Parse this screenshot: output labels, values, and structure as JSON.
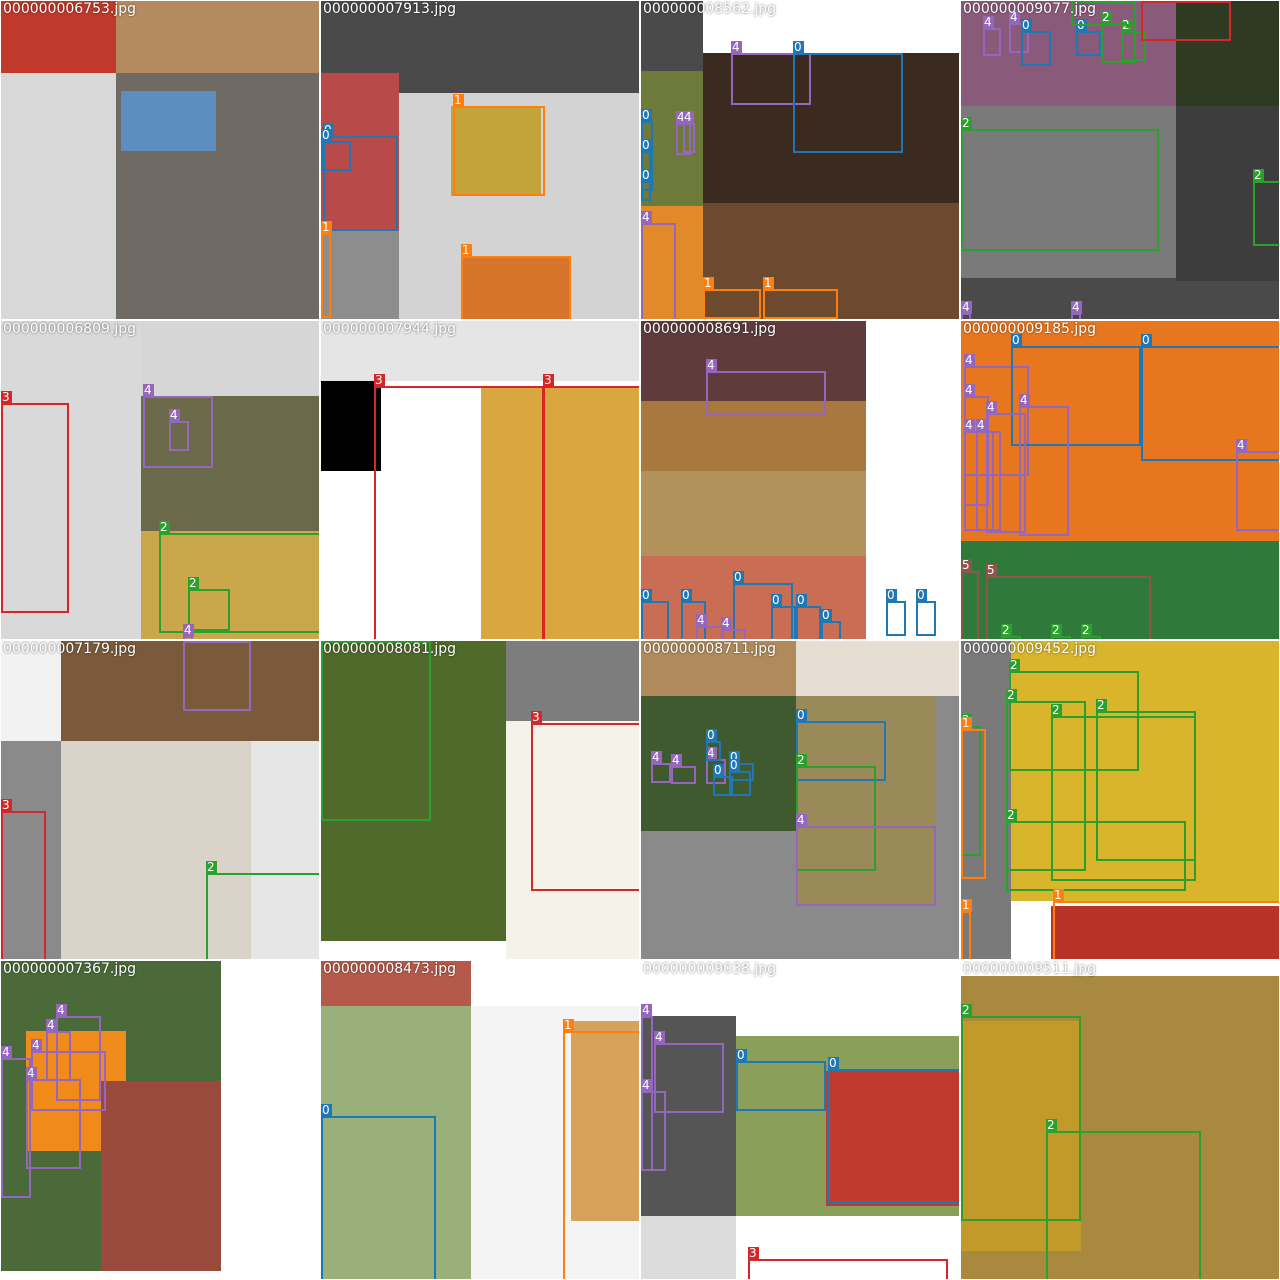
{
  "class_colors": {
    "0": "#1f77b4",
    "1": "#ff7f0e",
    "2": "#2ca02c",
    "3": "#d62728",
    "4": "#9467bd",
    "5": "#8c564b"
  },
  "tiles": [
    {
      "filename": "000000006753.jpg",
      "bg": "#d6d6d6",
      "areas": [
        {
          "kind": "photo",
          "color": "#c0392b"
        },
        {
          "kind": "photo",
          "color": "#b58a5f"
        },
        {
          "kind": "pad",
          "color": "#d8d8d8"
        },
        {
          "kind": "photo",
          "color": "#6f6a64"
        },
        {
          "kind": "photo",
          "color": "#5c8fbf"
        }
      ],
      "boxes": []
    },
    {
      "filename": "000000007913.jpg",
      "bg": "#4a4a4a",
      "areas": [
        {
          "kind": "photo",
          "color": "#b94a4a"
        },
        {
          "kind": "pad",
          "color": "#d3d3d3"
        },
        {
          "kind": "photo",
          "color": "#c4a33a"
        },
        {
          "kind": "photo",
          "color": "#d7742c"
        },
        {
          "kind": "photo",
          "color": "#8d8d8d"
        }
      ],
      "boxes": [
        {
          "cls": "1"
        },
        {
          "cls": "0"
        },
        {
          "cls": "0"
        },
        {
          "cls": "1"
        },
        {
          "cls": "1"
        }
      ]
    },
    {
      "filename": "000000008562.jpg",
      "bg": "#4a4a4a",
      "areas": [
        {
          "kind": "photo",
          "color": "#6e7a3a"
        },
        {
          "kind": "photo",
          "color": "#3a2a20"
        },
        {
          "kind": "photo",
          "color": "#6d4a2e"
        },
        {
          "kind": "photo",
          "color": "#e28a2a"
        },
        {
          "kind": "pad",
          "color": "#ffffff"
        }
      ],
      "boxes": [
        {
          "cls": "4"
        },
        {
          "cls": "0"
        },
        {
          "cls": "0"
        },
        {
          "cls": "0"
        },
        {
          "cls": "4"
        },
        {
          "cls": "4"
        },
        {
          "cls": "0"
        },
        {
          "cls": "4"
        },
        {
          "cls": "1"
        },
        {
          "cls": "1"
        }
      ]
    },
    {
      "filename": "000000009077.jpg",
      "bg": "#4a4a4a",
      "areas": [
        {
          "kind": "photo",
          "color": "#8a5a7a"
        },
        {
          "kind": "photo",
          "color": "#2f3a22"
        },
        {
          "kind": "photo",
          "color": "#7a7a7a"
        },
        {
          "kind": "photo",
          "color": "#3d3d3d"
        }
      ],
      "boxes": [
        {
          "cls": "4"
        },
        {
          "cls": "4"
        },
        {
          "cls": "0"
        },
        {
          "cls": "0"
        },
        {
          "cls": "2"
        },
        {
          "cls": "2"
        },
        {
          "cls": "2"
        },
        {
          "cls": "2"
        },
        {
          "cls": "3"
        },
        {
          "cls": "2"
        },
        {
          "cls": "4"
        },
        {
          "cls": "4"
        }
      ]
    },
    {
      "filename": "000000006809.jpg",
      "bg": "#d6d6d6",
      "areas": [
        {
          "kind": "pad",
          "color": "#d9d9d9"
        },
        {
          "kind": "photo",
          "color": "#000000"
        },
        {
          "kind": "photo",
          "color": "#6a6a4a"
        },
        {
          "kind": "photo",
          "color": "#c9a74a"
        }
      ],
      "boxes": [
        {
          "cls": "3"
        },
        {
          "cls": "4"
        },
        {
          "cls": "4"
        },
        {
          "cls": "2"
        },
        {
          "cls": "2"
        },
        {
          "cls": "4"
        },
        {
          "cls": "2"
        }
      ]
    },
    {
      "filename": "000000007944.jpg",
      "bg": "#ffffff",
      "areas": [
        {
          "kind": "photo",
          "color": "#e5e5e5"
        },
        {
          "kind": "photo",
          "color": "#000000"
        },
        {
          "kind": "photo",
          "color": "#ffffff"
        },
        {
          "kind": "photo",
          "color": "#d9a640"
        }
      ],
      "boxes": [
        {
          "cls": "3"
        },
        {
          "cls": "3"
        }
      ]
    },
    {
      "filename": "000000008691.jpg",
      "bg": "#ffffff",
      "areas": [
        {
          "kind": "photo",
          "color": "#5f3b3b"
        },
        {
          "kind": "photo",
          "color": "#a8783e"
        },
        {
          "kind": "photo",
          "color": "#b1925a"
        },
        {
          "kind": "photo",
          "color": "#c96e54"
        }
      ],
      "boxes": [
        {
          "cls": "4"
        },
        {
          "cls": "0"
        },
        {
          "cls": "0"
        },
        {
          "cls": "0"
        },
        {
          "cls": "0"
        },
        {
          "cls": "0"
        },
        {
          "cls": "0"
        },
        {
          "cls": "0"
        },
        {
          "cls": "0"
        },
        {
          "cls": "4"
        },
        {
          "cls": "4"
        }
      ]
    },
    {
      "filename": "000000009185.jpg",
      "bg": "#ffffff",
      "areas": [
        {
          "kind": "photo",
          "color": "#e8761e"
        },
        {
          "kind": "photo",
          "color": "#2f7a3a"
        }
      ],
      "boxes": [
        {
          "cls": "4"
        },
        {
          "cls": "4"
        },
        {
          "cls": "0"
        },
        {
          "cls": "0"
        },
        {
          "cls": "4"
        },
        {
          "cls": "4"
        },
        {
          "cls": "4"
        },
        {
          "cls": "4"
        },
        {
          "cls": "4"
        },
        {
          "cls": "5"
        },
        {
          "cls": "5"
        },
        {
          "cls": "2"
        },
        {
          "cls": "2"
        },
        {
          "cls": "2"
        }
      ]
    },
    {
      "filename": "000000007179.jpg",
      "bg": "#d6d6d6",
      "areas": [
        {
          "kind": "pad",
          "color": "#f2f2f2"
        },
        {
          "kind": "photo",
          "color": "#7a5a3a"
        },
        {
          "kind": "photo",
          "color": "#8a8a8a"
        },
        {
          "kind": "photo",
          "color": "#d9d3c9"
        },
        {
          "kind": "photo",
          "color": "#e6e6e6"
        }
      ],
      "boxes": [
        {
          "cls": "4"
        },
        {
          "cls": "3"
        },
        {
          "cls": "2"
        }
      ]
    },
    {
      "filename": "000000008081.jpg",
      "bg": "#ffffff",
      "areas": [
        {
          "kind": "photo",
          "color": "#4f6a2a"
        },
        {
          "kind": "pad",
          "color": "#7d7d7d"
        },
        {
          "kind": "photo",
          "color": "#f5f2ea"
        }
      ],
      "boxes": [
        {
          "cls": "2"
        },
        {
          "cls": "3"
        }
      ]
    },
    {
      "filename": "000000008711.jpg",
      "bg": "#8a8a8a",
      "areas": [
        {
          "kind": "photo",
          "color": "#b08a5a"
        },
        {
          "kind": "photo",
          "color": "#3e5a2e"
        },
        {
          "kind": "photo",
          "color": "#e6ded2"
        },
        {
          "kind": "photo",
          "color": "#9a8a5a"
        }
      ],
      "boxes": [
        {
          "cls": "0"
        },
        {
          "cls": "2"
        },
        {
          "cls": "4"
        },
        {
          "cls": "4"
        },
        {
          "cls": "4"
        },
        {
          "cls": "4"
        },
        {
          "cls": "0"
        },
        {
          "cls": "0"
        },
        {
          "cls": "0"
        },
        {
          "cls": "0"
        },
        {
          "cls": "0"
        }
      ]
    },
    {
      "filename": "000000009452.jpg",
      "bg": "#ffffff",
      "areas": [
        {
          "kind": "photo",
          "color": "#7a7a7a"
        },
        {
          "kind": "photo",
          "color": "#d8b52a"
        },
        {
          "kind": "photo",
          "color": "#b8322a"
        }
      ],
      "boxes": [
        {
          "cls": "2"
        },
        {
          "cls": "2"
        },
        {
          "cls": "2"
        },
        {
          "cls": "2"
        },
        {
          "cls": "2"
        },
        {
          "cls": "2"
        },
        {
          "cls": "1"
        },
        {
          "cls": "1"
        },
        {
          "cls": "1"
        }
      ]
    },
    {
      "filename": "000000007367.jpg",
      "bg": "#ffffff",
      "areas": [
        {
          "kind": "photo",
          "color": "#4a6a3a"
        },
        {
          "kind": "photo",
          "color": "#f08a1a"
        },
        {
          "kind": "photo",
          "color": "#9a4a3a"
        }
      ],
      "boxes": [
        {
          "cls": "4"
        },
        {
          "cls": "4"
        },
        {
          "cls": "4"
        },
        {
          "cls": "4"
        },
        {
          "cls": "4"
        }
      ]
    },
    {
      "filename": "000000008473.jpg",
      "bg": "#ffffff",
      "areas": [
        {
          "kind": "photo",
          "color": "#b55a4a"
        },
        {
          "kind": "photo",
          "color": "#9ab07a"
        },
        {
          "kind": "photo",
          "color": "#f4f4f4"
        },
        {
          "kind": "photo",
          "color": "#d7a35a"
        }
      ],
      "boxes": [
        {
          "cls": "1"
        },
        {
          "cls": "0"
        }
      ]
    },
    {
      "filename": "000000009038.jpg",
      "bg": "#ffffff",
      "areas": [
        {
          "kind": "photo",
          "color": "#555555"
        },
        {
          "kind": "photo",
          "color": "#8aa05a"
        },
        {
          "kind": "photo",
          "color": "#c0392b"
        },
        {
          "kind": "photo",
          "color": "#dcdcdc"
        }
      ],
      "boxes": [
        {
          "cls": "4"
        },
        {
          "cls": "4"
        },
        {
          "cls": "4"
        },
        {
          "cls": "0"
        },
        {
          "cls": "0"
        },
        {
          "cls": "3"
        }
      ]
    },
    {
      "filename": "000000009511.jpg",
      "bg": "#ffffff",
      "areas": [
        {
          "kind": "photo",
          "color": "#a8893e"
        },
        {
          "kind": "photo",
          "color": "#c29a2a"
        }
      ],
      "boxes": [
        {
          "cls": "2"
        },
        {
          "cls": "2"
        }
      ]
    }
  ]
}
